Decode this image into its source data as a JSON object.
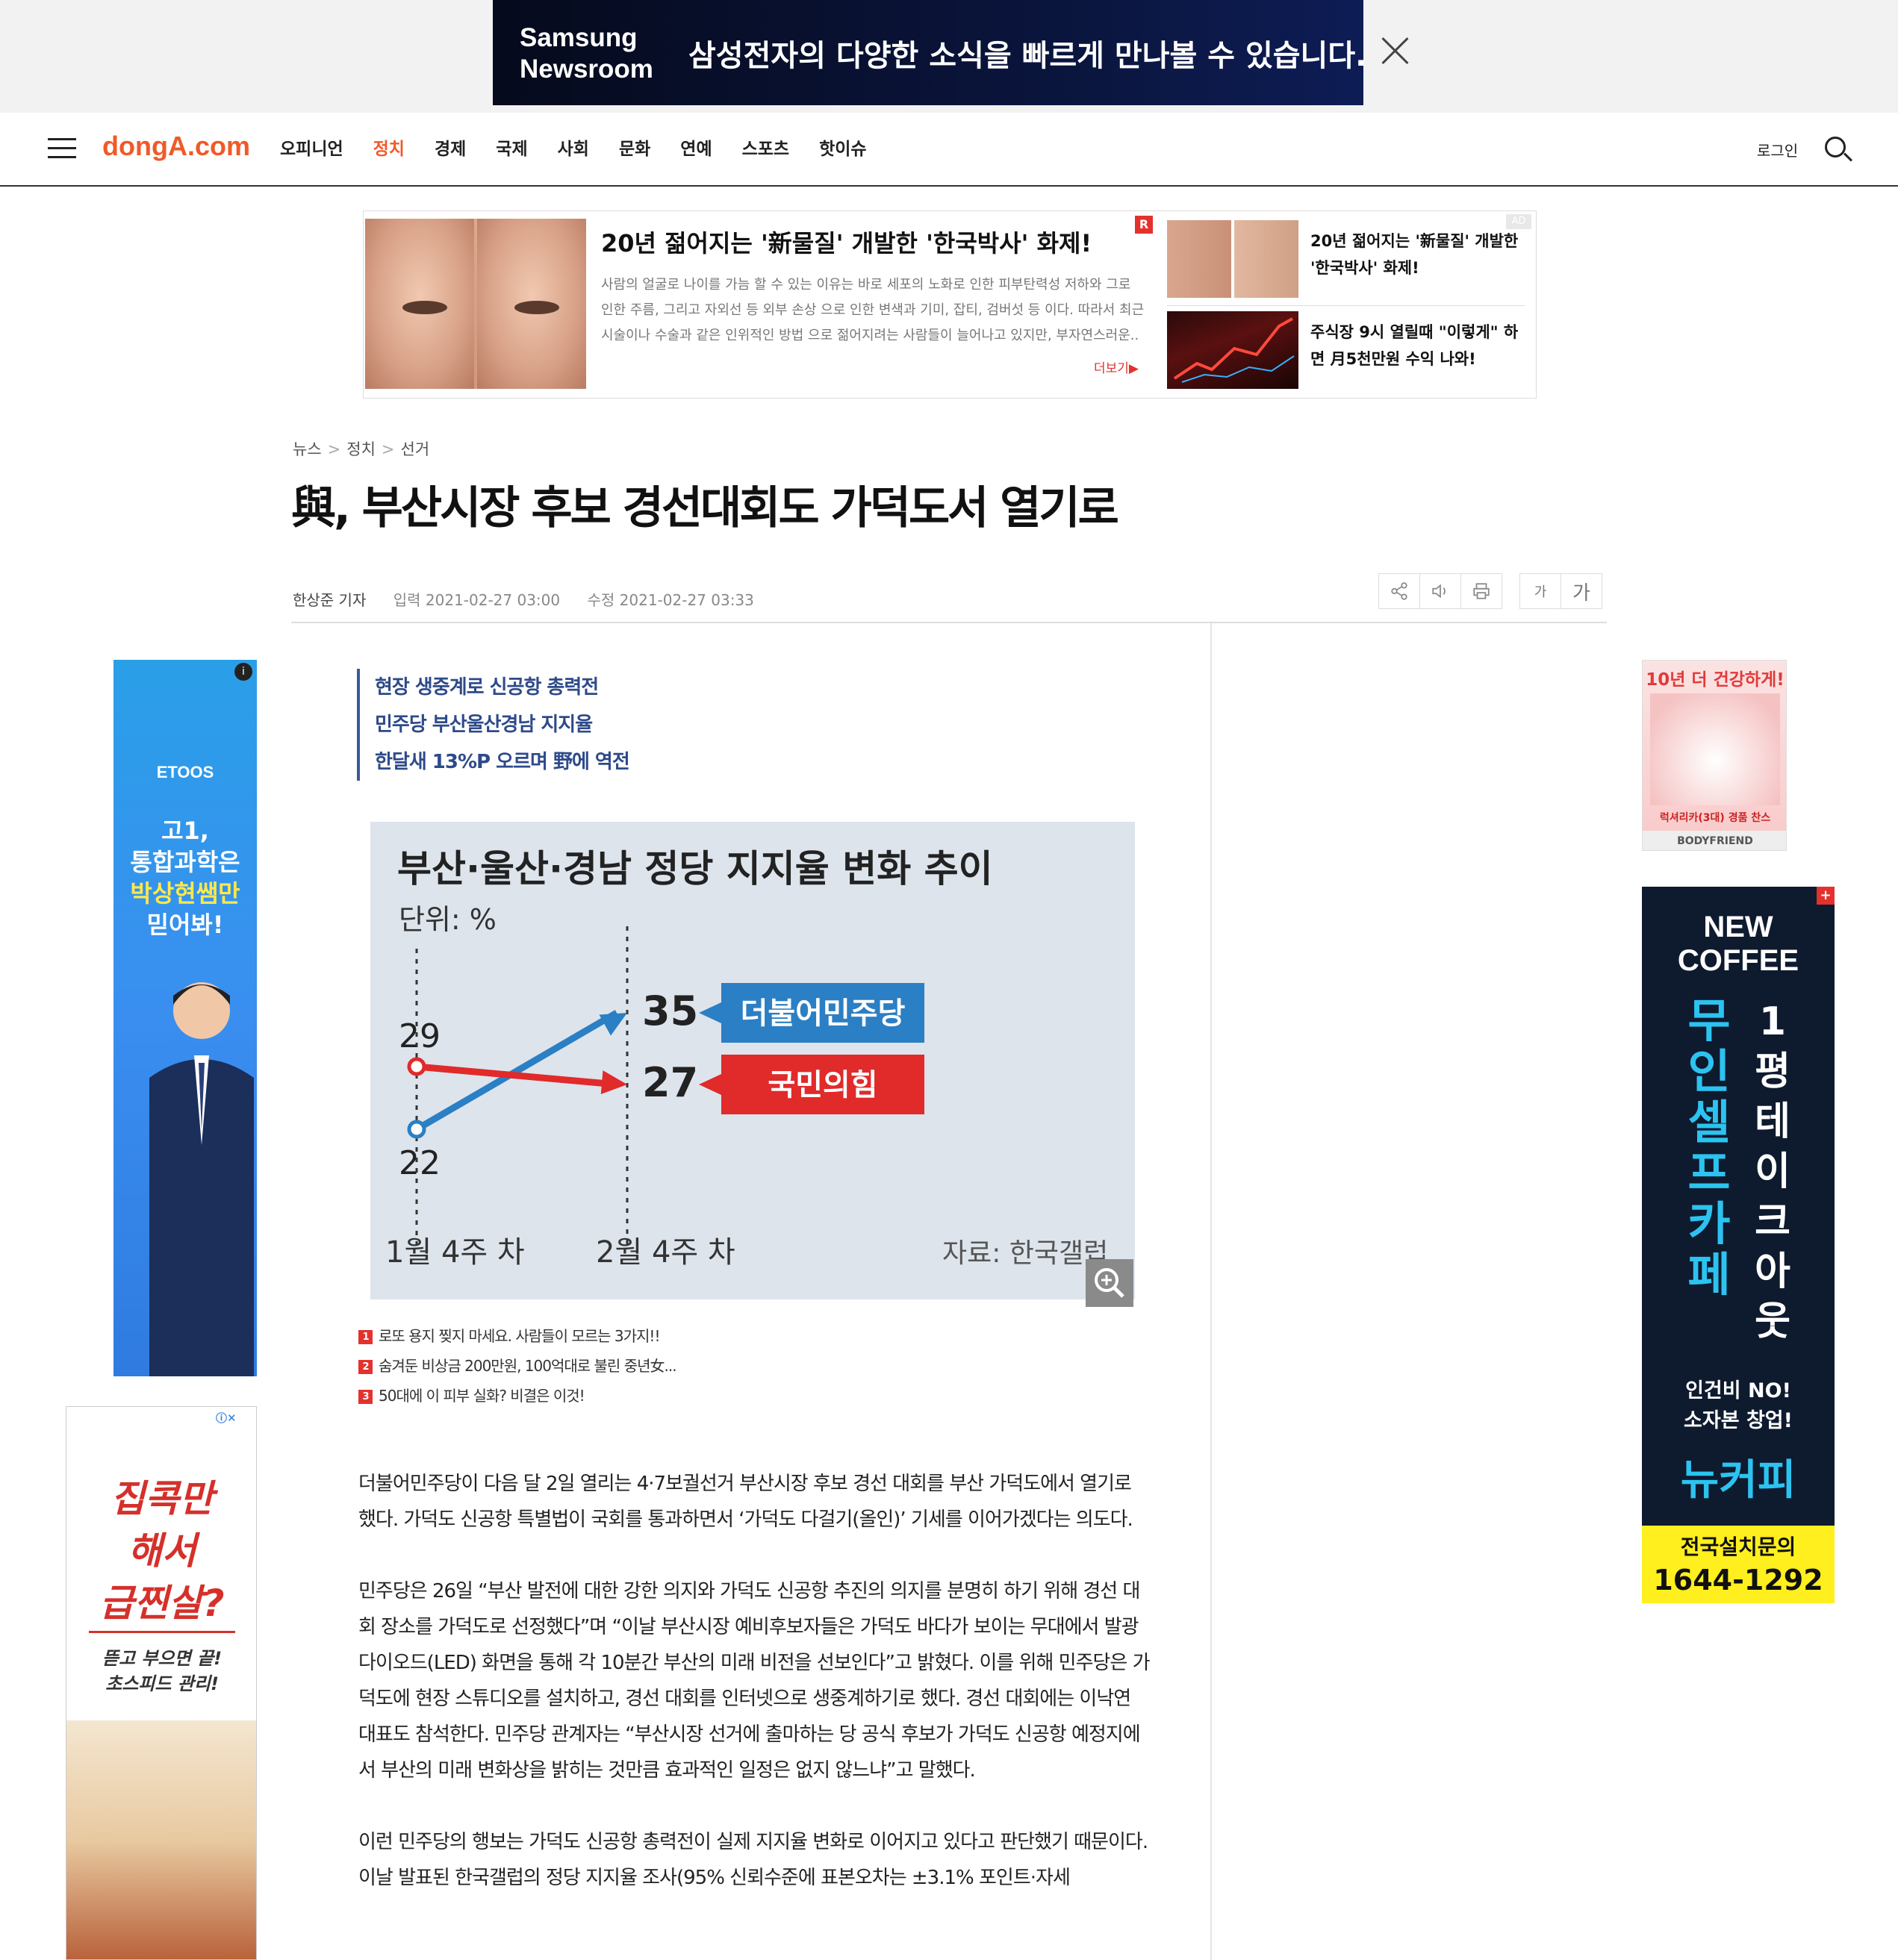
{
  "top_banner": {
    "brand_line1": "Samsung",
    "brand_line2": "Newsroom",
    "message": "삼성전자의 다양한 소식을 빠르게 만나볼 수 있습니다."
  },
  "header": {
    "logo": "dongA.com",
    "nav": [
      {
        "label": "오피니언",
        "active": false
      },
      {
        "label": "정치",
        "active": true
      },
      {
        "label": "경제",
        "active": false
      },
      {
        "label": "국제",
        "active": false
      },
      {
        "label": "사회",
        "active": false
      },
      {
        "label": "문화",
        "active": false
      },
      {
        "label": "연예",
        "active": false
      },
      {
        "label": "스포츠",
        "active": false
      },
      {
        "label": "핫이슈",
        "active": false
      }
    ],
    "login": "로그인",
    "accent_color": "#f05a28"
  },
  "top_ad": {
    "title": "20년 젊어지는 '新물질' 개발한 '한국박사' 화제!",
    "badge": "R",
    "description": "사람의 얼굴로 나이를 가늠 할 수 있는 이유는 바로 세포의 노화로 인한 피부탄력성 저하와 그로 인한 주름, 그리고 자외선 등 외부 손상 으로 인한 변색과 기미, 잡티, 검버섯 등 이다. 따라서 최근 시술이나 수술과 같은 인위적인 방법 으로 젊어지려는 사람들이 늘어나고 있지만, 부자연스러운..",
    "more": "더보기▶",
    "label": "AD",
    "side_items": [
      {
        "text": "20년 젊어지는 '新물질' 개발한 '한국박사' 화제!"
      },
      {
        "text": "주식장 9시 열릴때 \"이렇게\" 하면 月5천만원 수익 나와!"
      }
    ]
  },
  "article": {
    "breadcrumb": [
      "뉴스",
      "정치",
      "선거"
    ],
    "title": "與, 부산시장 후보 경선대회도 가덕도서 열기로",
    "reporter": "한상준 기자",
    "input_label": "입력",
    "input_date": "2021-02-27 03:00",
    "modified_label": "수정",
    "modified_date": "2021-02-27 03:33",
    "tools": {
      "share": "share-icon",
      "tts": "speaker-icon",
      "print": "print-icon",
      "font_small": "가",
      "font_large": "가"
    },
    "subtitles": [
      "현장 생중계로 신공항 총력전",
      "민주당 부산울산경남 지지율",
      "한달새 13%P 오르며 野에 역전"
    ],
    "ranking": [
      {
        "num": "1",
        "text": "로또 용지 찢지 마세요. 사람들이 모르는 3가지!!"
      },
      {
        "num": "2",
        "text": "숨겨둔 비상금 200만원, 100억대로 불린 중년女..."
      },
      {
        "num": "3",
        "text": "50대에 이 피부 실화? 비결은 이것!"
      }
    ],
    "paragraphs": [
      "더불어민주당이 다음 달 2일 열리는 4·7보궐선거 부산시장 후보 경선 대회를 부산 가덕도에서 열기로 했다. 가덕도 신공항 특별법이 국회를 통과하면서 ‘가덕도 다걸기(올인)’ 기세를 이어가겠다는 의도다.",
      "민주당은 26일 “부산 발전에 대한 강한 의지와 가덕도 신공항 추진의 의지를 분명히 하기 위해 경선 대회 장소를 가덕도로 선정했다”며 “이날 부산시장 예비후보자들은 가덕도 바다가 보이는 무대에서 발광다이오드(LED) 화면을 통해 각 10분간 부산의 미래 비전을 선보인다”고 밝혔다. 이를 위해 민주당은 가덕도에 현장 스튜디오를 설치하고, 경선 대회를 인터넷으로 생중계하기로 했다. 경선 대회에는 이낙연 대표도 참석한다. 민주당 관계자는 “부산시장 선거에 출마하는 당 공식 후보가 가덕도 신공항 예정지에서 부산의 미래 변화상을 밝히는 것만큼 효과적인 일정은 없지 않느냐”고 말했다.",
      "이런 민주당의 행보는 가덕도 신공항 총력전이 실제 지지율 변화로 이어지고 있다고 판단했기 때문이다. 이날 발표된 한국갤럽의 정당 지지율 조사(95% 신뢰수준에 표본오차는 ±3.1% 포인트·자세"
    ]
  },
  "chart_data": {
    "type": "line",
    "title": "부산·울산·경남 정당 지지율 변화 추이",
    "unit": "단위: %",
    "source": "자료: 한국갤럽",
    "categories": [
      "1월 4주 차",
      "2월 4주 차"
    ],
    "series": [
      {
        "name": "더불어민주당",
        "values": [
          22,
          35
        ],
        "color": "#2b7fc4"
      },
      {
        "name": "국민의힘",
        "values": [
          29,
          27
        ],
        "color": "#e12a2a"
      }
    ],
    "ylim": [
      18,
      38
    ],
    "background": "#dde4ec"
  },
  "side_ads": {
    "etoos": {
      "logo": "ETOOS",
      "line1": "고1,",
      "line2": "통합과학은",
      "line3": "박상현쌤만",
      "line4": "믿어봐!"
    },
    "diet": {
      "line1": "집콕만",
      "line2": "해서",
      "line3": "급찐살?",
      "sub1": "뜯고 부으면 끝!",
      "sub2": "초스피드 관리!"
    },
    "bodyfriend": {
      "top": "10년 더 건강하게!",
      "product": "럭셔리카(3대) 경품 찬스",
      "brand": "BODYFRIEND"
    },
    "newcoffee": {
      "logo": "NEW COFFEE",
      "col1": [
        "무",
        "인",
        "셀",
        "프",
        "카",
        "페"
      ],
      "col2": [
        "1",
        "평",
        "테",
        "이",
        "크",
        "아",
        "웃"
      ],
      "small1": "인건비 NO!",
      "small2": "소자본 창업!",
      "big": "뉴커피",
      "foot1": "전국설치문의",
      "foot2": "1644-1292"
    }
  }
}
